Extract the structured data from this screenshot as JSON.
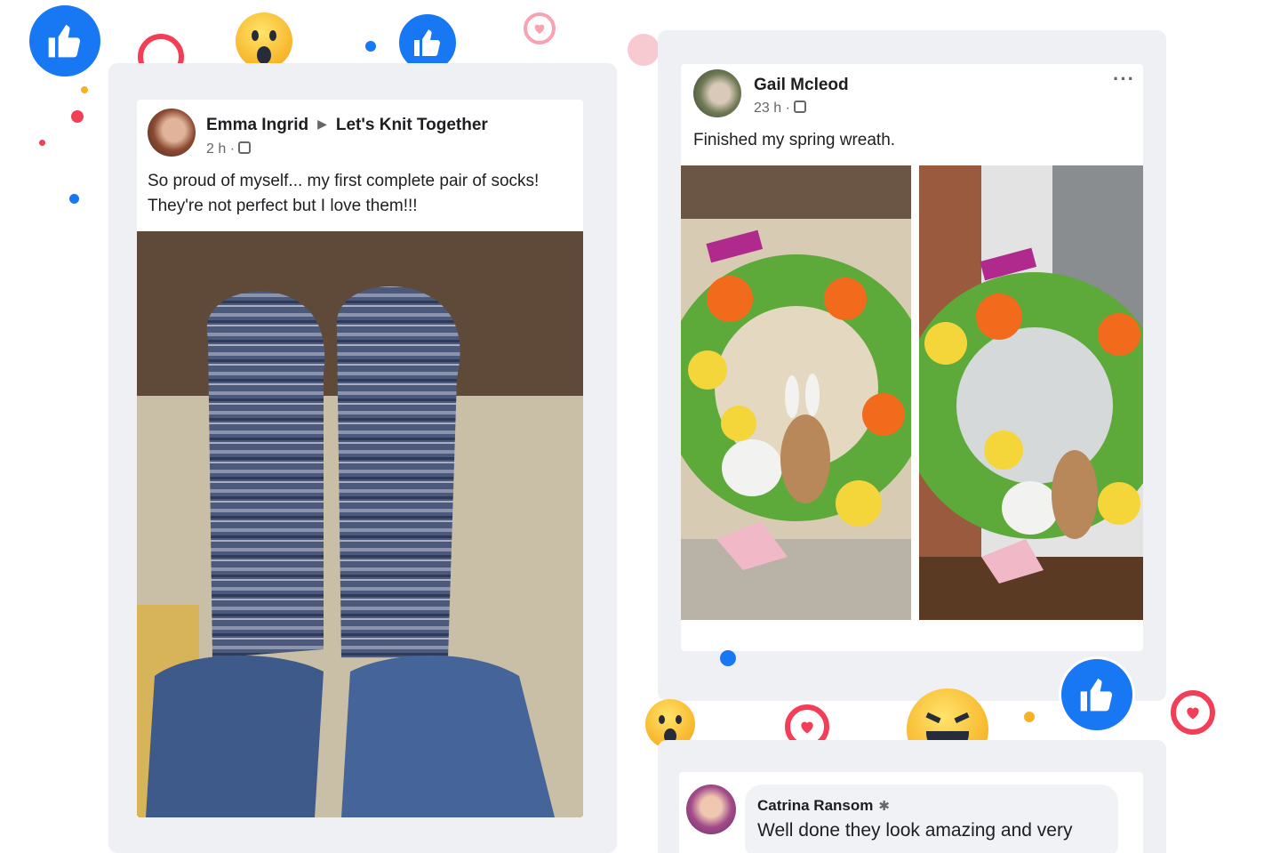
{
  "colors": {
    "facebook_blue": "#1877f2",
    "love_red": "#f33e58",
    "panel_bg": "#eef0f3",
    "card_bg": "#ffffff",
    "muted_text": "#65676b"
  },
  "posts": [
    {
      "author": "Emma Ingrid",
      "group": "Let's Knit Together",
      "time": "2 h ·",
      "privacy_icon": "group-privacy-icon",
      "text": "So proud of myself... my first complete pair of socks! They're not perfect but I love them!!!",
      "photo": "knitted-socks-photo"
    },
    {
      "author": "Gail Mcleod",
      "time": "23 h ·",
      "privacy_icon": "group-privacy-icon",
      "more_label": "···",
      "text": "Finished my spring wreath.",
      "photos": [
        "spring-wreath-photo-1",
        "spring-wreath-photo-2"
      ]
    }
  ],
  "comment": {
    "author": "Catrina Ransom",
    "badge_icon": "star-icon",
    "badge": "✱",
    "text": "Well done they look amazing and very"
  },
  "reactions": [
    "like",
    "love",
    "wow",
    "haha"
  ]
}
